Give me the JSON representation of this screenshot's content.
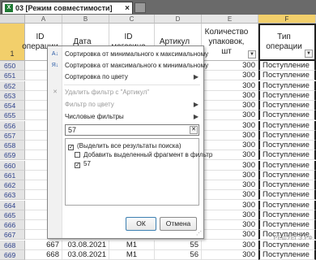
{
  "tab": {
    "title": "03  [Режим совместимости]",
    "close": "×"
  },
  "columns": [
    {
      "letter": "A",
      "header": "ID операции"
    },
    {
      "letter": "B",
      "header": "Дата"
    },
    {
      "letter": "C",
      "header": "ID магазина"
    },
    {
      "letter": "D",
      "header": "Артикул"
    },
    {
      "letter": "E",
      "header": "Количество упаковок, шт"
    },
    {
      "letter": "F",
      "header": "Тип операции"
    }
  ],
  "header_row_number": "1",
  "rows": [
    {
      "num": "650",
      "a": "",
      "b": "",
      "c": "",
      "d": "",
      "e": "300",
      "f": "Поступление"
    },
    {
      "num": "651",
      "a": "",
      "b": "",
      "c": "",
      "d": "",
      "e": "300",
      "f": "Поступление"
    },
    {
      "num": "652",
      "a": "",
      "b": "",
      "c": "",
      "d": "",
      "e": "300",
      "f": "Поступление"
    },
    {
      "num": "653",
      "a": "",
      "b": "",
      "c": "",
      "d": "",
      "e": "300",
      "f": "Поступление"
    },
    {
      "num": "654",
      "a": "",
      "b": "",
      "c": "",
      "d": "",
      "e": "300",
      "f": "Поступление"
    },
    {
      "num": "655",
      "a": "",
      "b": "",
      "c": "",
      "d": "",
      "e": "300",
      "f": "Поступление"
    },
    {
      "num": "656",
      "a": "",
      "b": "",
      "c": "",
      "d": "",
      "e": "300",
      "f": "Поступление"
    },
    {
      "num": "657",
      "a": "",
      "b": "",
      "c": "",
      "d": "",
      "e": "300",
      "f": "Поступление"
    },
    {
      "num": "658",
      "a": "",
      "b": "",
      "c": "",
      "d": "",
      "e": "300",
      "f": "Поступление"
    },
    {
      "num": "659",
      "a": "",
      "b": "",
      "c": "",
      "d": "",
      "e": "300",
      "f": "Поступление"
    },
    {
      "num": "660",
      "a": "",
      "b": "",
      "c": "",
      "d": "",
      "e": "300",
      "f": "Поступление"
    },
    {
      "num": "661",
      "a": "",
      "b": "",
      "c": "",
      "d": "",
      "e": "300",
      "f": "Поступление"
    },
    {
      "num": "662",
      "a": "",
      "b": "",
      "c": "",
      "d": "",
      "e": "300",
      "f": "Поступление"
    },
    {
      "num": "663",
      "a": "",
      "b": "",
      "c": "",
      "d": "",
      "e": "300",
      "f": "Поступление"
    },
    {
      "num": "664",
      "a": "",
      "b": "",
      "c": "",
      "d": "",
      "e": "300",
      "f": "Поступление"
    },
    {
      "num": "665",
      "a": "",
      "b": "",
      "c": "",
      "d": "",
      "e": "300",
      "f": "Поступление"
    },
    {
      "num": "666",
      "a": "",
      "b": "",
      "c": "",
      "d": "",
      "e": "300",
      "f": "Поступление"
    },
    {
      "num": "667",
      "a": "",
      "b": "",
      "c": "",
      "d": "",
      "e": "300",
      "f": "Поступление"
    },
    {
      "num": "668",
      "a": "667",
      "b": "03.08.2021",
      "c": "M1",
      "d": "55",
      "e": "300",
      "f": "Поступление"
    },
    {
      "num": "669",
      "a": "668",
      "b": "03.08.2021",
      "c": "M1",
      "d": "56",
      "e": "300",
      "f": "Поступление"
    }
  ],
  "menu": {
    "sort_asc": "Сортировка от минимального к максимальному",
    "sort_desc": "Сортировка от максимального к минимальному",
    "sort_color": "Сортировка по цвету",
    "remove_filter": "Удалить фильтр с \"Артикул\"",
    "filter_color": "Фильтр по цвету",
    "number_filters": "Числовые фильтры",
    "search_value": "57",
    "items": [
      {
        "label": "(Выделить все результаты поиска)",
        "checked": "✓"
      },
      {
        "label": "Добавить выделенный фрагмент в фильтр",
        "checked": ""
      },
      {
        "label": "57",
        "checked": "✓"
      }
    ],
    "ok": "ОК",
    "cancel": "Отмена"
  },
  "watermark": "РЕШУЕГЭ.РФ",
  "colors": {
    "selected_header": "#f2cf6b",
    "row_number_text": "#2b3f8a",
    "excel_green": "#1f7a34"
  }
}
